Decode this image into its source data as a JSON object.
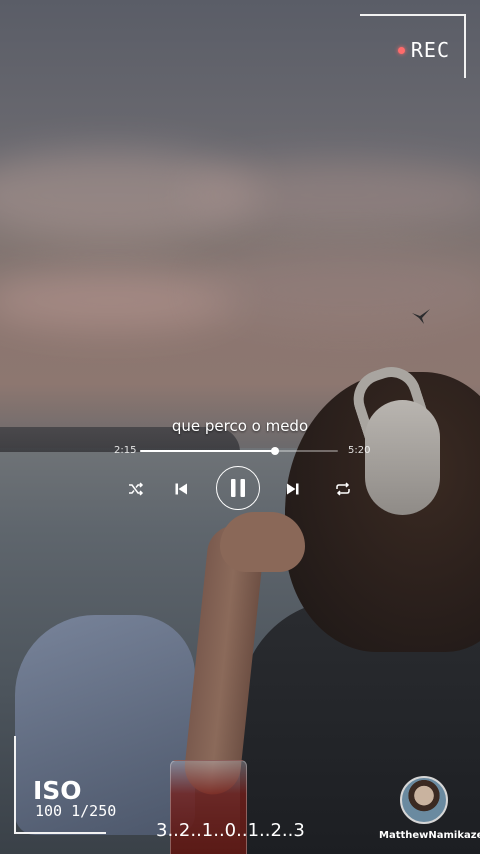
{
  "overlay": {
    "rec_label": "REC",
    "song_title": "que perco o medo",
    "time_elapsed": "2:15",
    "time_total": "5:20",
    "progress": 0.68,
    "iso_label": "ISO",
    "iso_values": "100 1/250",
    "exposure_scale": "3..2..1..0..1..2..3",
    "username": "MatthewNamikaze"
  },
  "controls": {
    "shuffle_icon": "shuffle-icon",
    "previous_icon": "skip-previous-icon",
    "play_pause_icon": "pause-icon",
    "next_icon": "skip-next-icon",
    "repeat_icon": "repeat-icon"
  },
  "colors": {
    "rec_dot": "#ff6b6b",
    "text": "#ffffff"
  }
}
